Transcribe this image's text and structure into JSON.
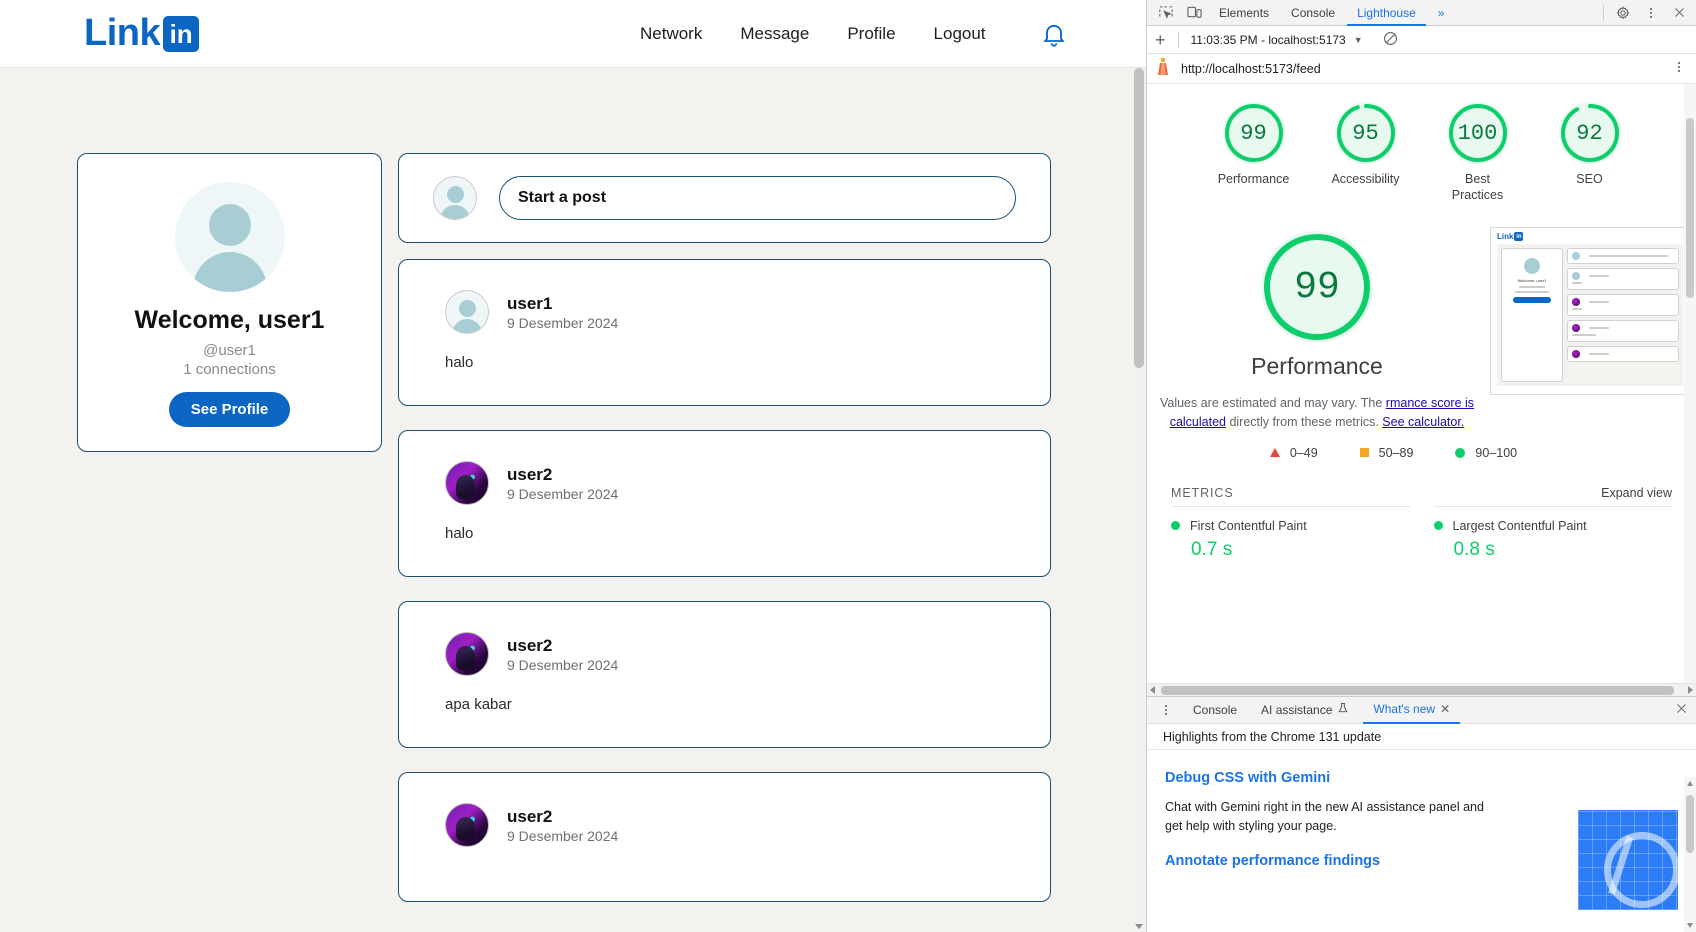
{
  "app": {
    "brand": {
      "text": "Link",
      "badge": "in"
    },
    "nav": [
      {
        "label": "Network"
      },
      {
        "label": "Message"
      },
      {
        "label": "Profile"
      },
      {
        "label": "Logout"
      }
    ],
    "notification_icon": "bell-icon",
    "profile_card": {
      "welcome": "Welcome, user1",
      "handle": "@user1",
      "connections": "1 connections",
      "button": "See Profile"
    },
    "composer": {
      "placeholder": "Start a post"
    },
    "posts": [
      {
        "author": "user1",
        "date": "9 Desember 2024",
        "body": "halo",
        "avatar": "default"
      },
      {
        "author": "user2",
        "date": "9 Desember 2024",
        "body": "halo",
        "avatar": "photo"
      },
      {
        "author": "user2",
        "date": "9 Desember 2024",
        "body": "apa kabar",
        "avatar": "photo"
      },
      {
        "author": "user2",
        "date": "9 Desember 2024",
        "body": "",
        "avatar": "photo"
      }
    ]
  },
  "devtools": {
    "tabs": [
      {
        "label": "Elements",
        "active": false
      },
      {
        "label": "Console",
        "active": false
      },
      {
        "label": "Lighthouse",
        "active": true
      }
    ],
    "more_tabs": "»",
    "settings_icon": "gear-icon",
    "kebab_icon": "more-vertical-icon",
    "close_icon": "close-icon",
    "inspect_icon": "inspect-element-icon",
    "device_icon": "device-toolbar-icon"
  },
  "lighthouse": {
    "new_run_icon": "plus-icon",
    "run_selector": "11:03:35 PM - localhost:5173",
    "clear_icon": "no-entry-icon",
    "url": "http://localhost:5173/feed",
    "kebab_icon": "more-vertical-icon",
    "gauges": [
      {
        "score": "99",
        "label": "Performance"
      },
      {
        "score": "95",
        "label": "Accessibility"
      },
      {
        "score": "100",
        "label": "Best\nPractices"
      },
      {
        "score": "92",
        "label": "SEO"
      }
    ],
    "hero": {
      "score": "99",
      "label": "Performance",
      "disclaimer_1": "Values are estimated and may vary. The",
      "disclaimer_link_1": "rmance score is calculated",
      "disclaimer_2": " directly from these",
      "disclaimer_3": "metrics. ",
      "disclaimer_link_2": "See calculator."
    },
    "legend": [
      {
        "range": "0–49",
        "shape": "triangle",
        "color": "#e8453c"
      },
      {
        "range": "50–89",
        "shape": "square",
        "color": "#f5a623"
      },
      {
        "range": "90–100",
        "shape": "circle",
        "color": "#0cce6b"
      }
    ],
    "metrics_header": "METRICS",
    "expand_view": "Expand view",
    "metrics": [
      {
        "name": "First Contentful Paint",
        "value": "0.7 s",
        "status_color": "#0cce6b"
      },
      {
        "name": "Largest Contentful Paint",
        "value": "0.8 s",
        "status_color": "#0cce6b"
      }
    ]
  },
  "drawer": {
    "kebab_icon": "more-vertical-icon",
    "tabs": [
      {
        "label": "Console",
        "active": false,
        "icon": null
      },
      {
        "label": "AI assistance",
        "active": false,
        "icon": "flask-icon"
      },
      {
        "label": "What's new",
        "active": true,
        "icon": null
      }
    ],
    "close_tab_icon": "close-icon",
    "close_drawer_icon": "close-icon",
    "subtitle": "Highlights from the Chrome 131 update",
    "articles": [
      {
        "title": "Debug CSS with Gemini",
        "body": "Chat with Gemini right in the new AI assistance panel and get help with styling your page."
      },
      {
        "title": "Annotate performance findings",
        "body": ""
      }
    ]
  },
  "colors": {
    "brand_blue": "#0a66c2",
    "good_green": "#0cce6b",
    "score_text_green": "#0b7a3e",
    "devtools_blue": "#1a73e8",
    "page_bg": "#f3f2ef"
  }
}
